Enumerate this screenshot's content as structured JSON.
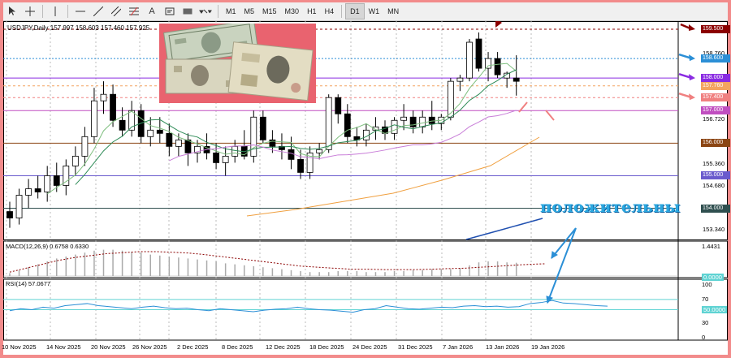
{
  "toolbar": {
    "timeframes": [
      "M1",
      "M5",
      "M15",
      "M30",
      "H1",
      "H4",
      "D1",
      "W1",
      "MN"
    ],
    "active_timeframe": "D1",
    "text_tool": "A"
  },
  "chart_header": "USDJPY,Daily  157.997 158.603 157.460 157.925",
  "price_axis": [
    "159.500",
    "158.760",
    "158.600",
    "158.000",
    "157.760",
    "157.400",
    "157.000",
    "156.720",
    "156.000",
    "155.360",
    "155.000",
    "154.680",
    "154.000",
    "153.340"
  ],
  "price_labels": [
    {
      "text": "159.500",
      "color": "#8b0000"
    },
    {
      "text": "158.600",
      "color": "#2b8fd6"
    },
    {
      "text": "158.000",
      "color": "#8a2be2"
    },
    {
      "text": "157.760",
      "color": "#f4a460"
    },
    {
      "text": "157.400",
      "color": "#f08080"
    },
    {
      "text": "157.000",
      "color": "#c04ec0"
    },
    {
      "text": "156.000",
      "color": "#8b4513"
    },
    {
      "text": "155.000",
      "color": "#6a5acd"
    },
    {
      "text": "154.000",
      "color": "#2f4f4f"
    }
  ],
  "macd": {
    "title": "MACD(12,26,9) 0.6758 0.6330",
    "axis_top": "1.4431",
    "axis_zero": "0.0000"
  },
  "rsi": {
    "title": "RSI(14) 57.0677",
    "axis": [
      "100",
      "70",
      "50.0000",
      "30",
      "0"
    ]
  },
  "dates": [
    "10 Nov 2025",
    "14 Nov 2025",
    "20 Nov 2025",
    "26 Nov 2025",
    "2 Dec 2025",
    "8 Dec 2025",
    "12 Dec 2025",
    "18 Dec 2025",
    "24 Dec 2025",
    "31 Dec 2025",
    "7 Jan 2026",
    "13 Jan 2026",
    "19 Jan 2026"
  ],
  "annotation": "положительны",
  "colors": {
    "bull": "#ffffff",
    "bear": "#000000",
    "ma_green": "#2e8b57",
    "ma_violet": "#c87dd8",
    "ma_orange": "#f0a040",
    "ma_blue": "#2050b0",
    "arrow_blue": "#2b8fd6",
    "arrow_red": "#8b0000",
    "arrow_purple": "#8a2be2",
    "arrow_pink": "#f08080"
  }
}
